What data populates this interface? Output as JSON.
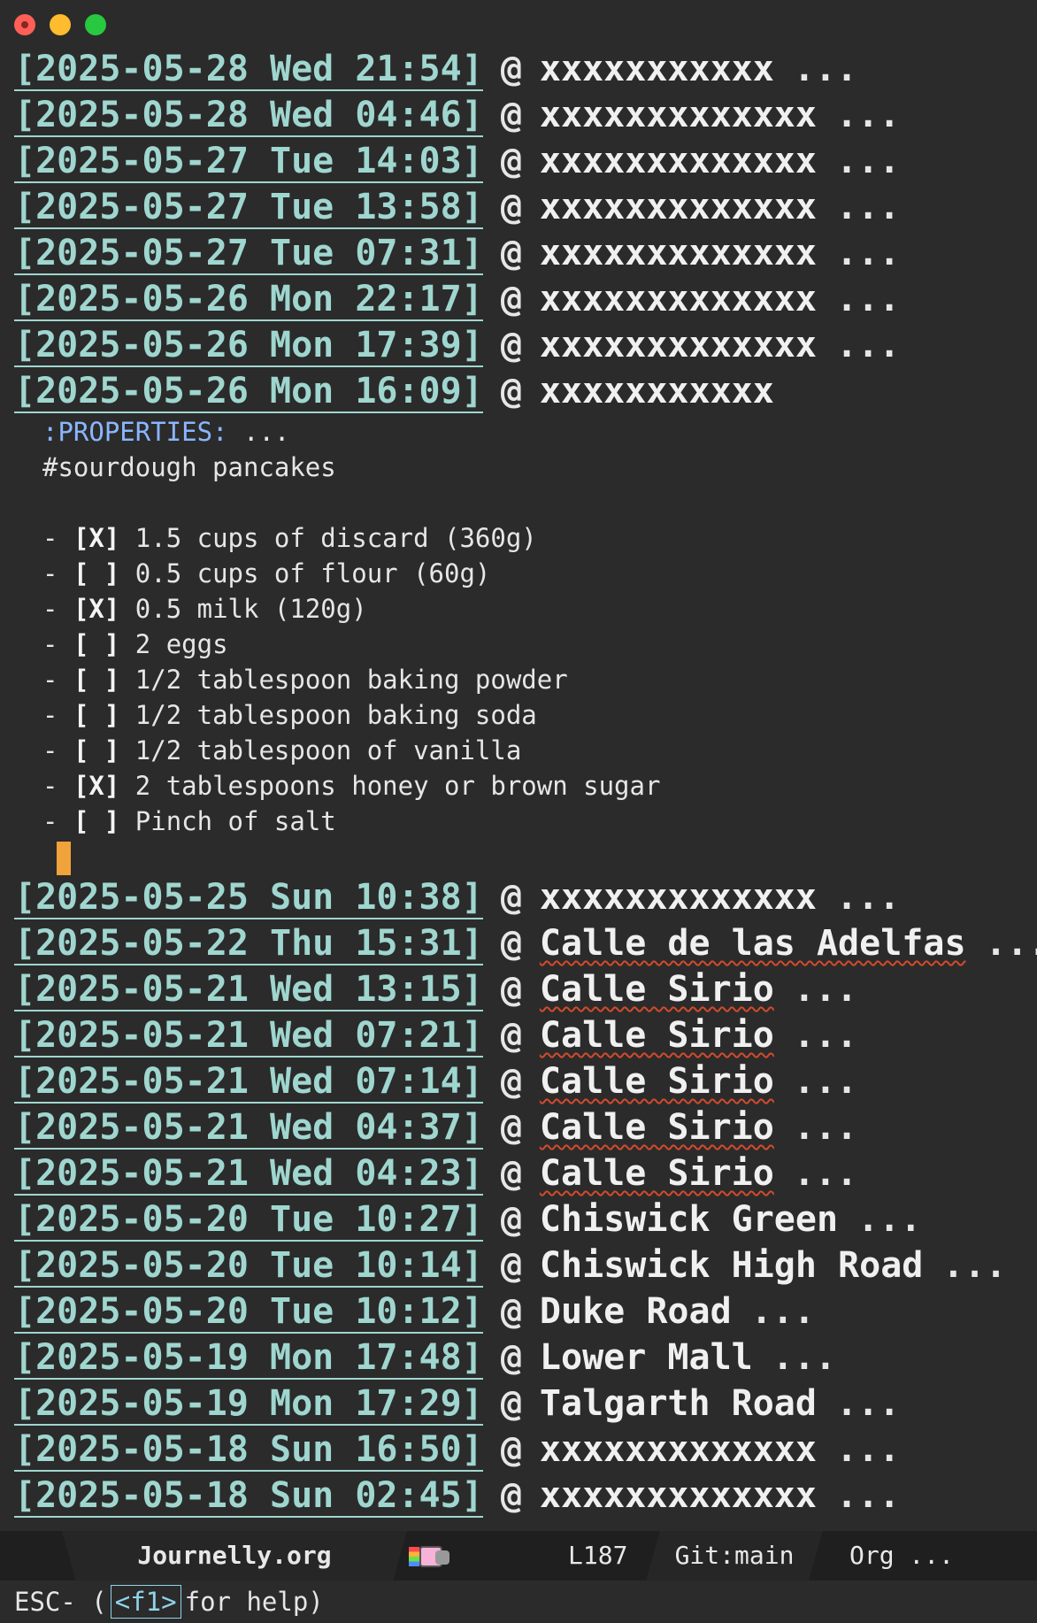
{
  "window": {
    "controls": [
      "close",
      "minimize",
      "maximize"
    ]
  },
  "headings_before": [
    {
      "ts": "[2025-05-28 Wed 21:54]",
      "at": "@",
      "place": "xxxxxxxxxxx",
      "ell": "..."
    },
    {
      "ts": "[2025-05-28 Wed 04:46]",
      "at": "@",
      "place": "xxxxxxxxxxxxx",
      "ell": "..."
    },
    {
      "ts": "[2025-05-27 Tue 14:03]",
      "at": "@",
      "place": "xxxxxxxxxxxxx",
      "ell": "..."
    },
    {
      "ts": "[2025-05-27 Tue 13:58]",
      "at": "@",
      "place": "xxxxxxxxxxxxx",
      "ell": "..."
    },
    {
      "ts": "[2025-05-27 Tue 07:31]",
      "at": "@",
      "place": "xxxxxxxxxxxxx",
      "ell": "..."
    },
    {
      "ts": "[2025-05-26 Mon 22:17]",
      "at": "@",
      "place": "xxxxxxxxxxxxx",
      "ell": "..."
    },
    {
      "ts": "[2025-05-26 Mon 17:39]",
      "at": "@",
      "place": "xxxxxxxxxxxxx",
      "ell": "..."
    }
  ],
  "open_heading": {
    "ts": "[2025-05-26 Mon 16:09]",
    "at": "@",
    "place": "xxxxxxxxxxx"
  },
  "entry": {
    "properties": ":PROPERTIES:",
    "properties_ell": "...",
    "tag_line": "#sourdough pancakes",
    "checklist": [
      {
        "bullet": "-",
        "box": "[X]",
        "text": "1.5 cups of discard (360g)"
      },
      {
        "bullet": "-",
        "box": "[ ]",
        "text": "0.5 cups of flour (60g)"
      },
      {
        "bullet": "-",
        "box": "[X]",
        "text": "0.5 milk (120g)"
      },
      {
        "bullet": "-",
        "box": "[ ]",
        "text": "2 eggs"
      },
      {
        "bullet": "-",
        "box": "[ ]",
        "text": "1/2 tablespoon baking powder"
      },
      {
        "bullet": "-",
        "box": "[ ]",
        "text": "1/2 tablespoon baking soda"
      },
      {
        "bullet": "-",
        "box": "[ ]",
        "text": "1/2 tablespoon of vanilla"
      },
      {
        "bullet": "-",
        "box": "[X]",
        "text": "2 tablespoons honey or brown sugar"
      },
      {
        "bullet": "-",
        "box": "[ ]",
        "text": "Pinch of salt"
      }
    ]
  },
  "headings_after": [
    {
      "ts": "[2025-05-25 Sun 10:38]",
      "at": "@",
      "place": "xxxxxxxxxxxxx",
      "ell": "...",
      "spell": false
    },
    {
      "ts": "[2025-05-22 Thu 15:31]",
      "at": "@",
      "place": "Calle de las Adelfas",
      "ell": "...",
      "spell": true
    },
    {
      "ts": "[2025-05-21 Wed 13:15]",
      "at": "@",
      "place": "Calle Sirio",
      "ell": "...",
      "spell": true
    },
    {
      "ts": "[2025-05-21 Wed 07:21]",
      "at": "@",
      "place": "Calle Sirio",
      "ell": "...",
      "spell": true
    },
    {
      "ts": "[2025-05-21 Wed 07:14]",
      "at": "@",
      "place": "Calle Sirio",
      "ell": "...",
      "spell": true
    },
    {
      "ts": "[2025-05-21 Wed 04:37]",
      "at": "@",
      "place": "Calle Sirio",
      "ell": "...",
      "spell": true
    },
    {
      "ts": "[2025-05-21 Wed 04:23]",
      "at": "@",
      "place": "Calle Sirio",
      "ell": "...",
      "spell": true
    },
    {
      "ts": "[2025-05-20 Tue 10:27]",
      "at": "@",
      "place": "Chiswick Green",
      "ell": "...",
      "spell": false
    },
    {
      "ts": "[2025-05-20 Tue 10:14]",
      "at": "@",
      "place": "Chiswick High Road",
      "ell": "...",
      "spell": false
    },
    {
      "ts": "[2025-05-20 Tue 10:12]",
      "at": "@",
      "place": "Duke Road",
      "ell": "...",
      "spell": false
    },
    {
      "ts": "[2025-05-19 Mon 17:48]",
      "at": "@",
      "place": "Lower Mall",
      "ell": "...",
      "spell": false
    },
    {
      "ts": "[2025-05-19 Mon 17:29]",
      "at": "@",
      "place": "Talgarth Road",
      "ell": "...",
      "spell": false
    },
    {
      "ts": "[2025-05-18 Sun 16:50]",
      "at": "@",
      "place": "xxxxxxxxxxxxx",
      "ell": "...",
      "spell": false
    },
    {
      "ts": "[2025-05-18 Sun 02:45]",
      "at": "@",
      "place": "xxxxxxxxxxxxx",
      "ell": "...",
      "spell": false
    }
  ],
  "modeline": {
    "buffer": "Journelly.org",
    "nyan_icon": "nyan-cat-icon",
    "line": "L187",
    "vcs": "Git:main",
    "mode": "Org ..."
  },
  "minibuffer": {
    "prefix": "ESC- (",
    "key": "<f1>",
    "suffix": "for help)"
  },
  "colors": {
    "background": "#2b2b2b",
    "timestamp": "#9fd6cf",
    "properties": "#8ab6ff",
    "cursor": "#f0a23b",
    "spell_underline": "#d24a2c"
  }
}
